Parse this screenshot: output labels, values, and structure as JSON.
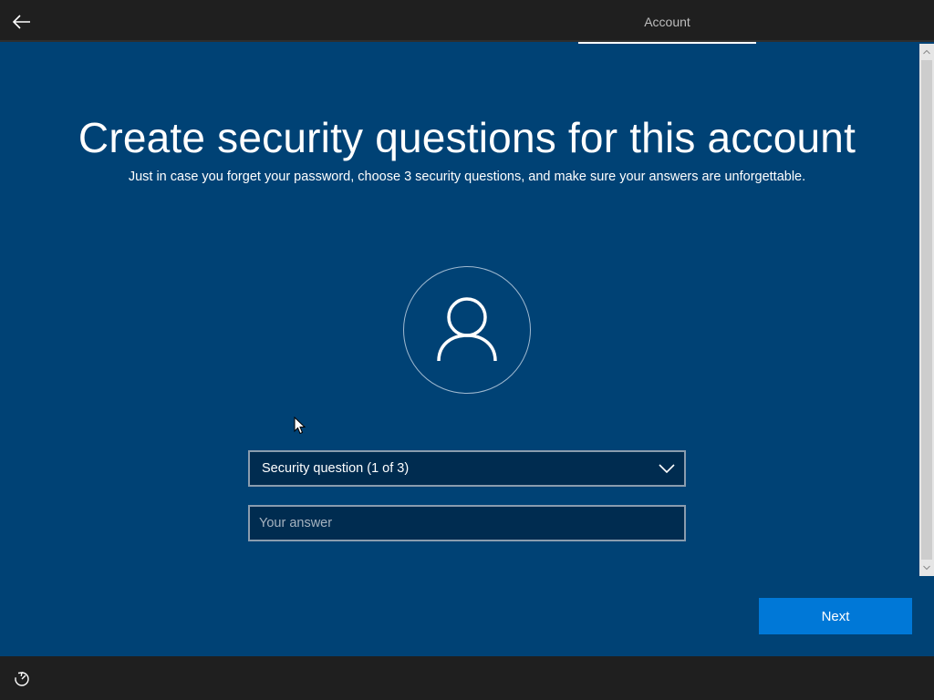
{
  "header": {
    "back_icon": "arrow-left-icon",
    "active_tab_label": "Account"
  },
  "main": {
    "title": "Create security questions for this account",
    "subtitle": "Just in case you forget your password, choose 3 security questions, and make sure your answers are unforgettable.",
    "avatar_icon": "user-icon",
    "security_question_select": {
      "selected_value": "Security question (1 of 3)",
      "chevron_icon": "chevron-down-icon"
    },
    "answer_field": {
      "value": "",
      "placeholder": "Your answer"
    },
    "next_label": "Next"
  },
  "footer": {
    "accessibility_icon": "ease-of-access-icon"
  },
  "colors": {
    "background": "#004275",
    "bar": "#1f1f1f",
    "field_background": "#002c50",
    "field_border": "#8a9cae",
    "accent": "#0078d7"
  }
}
